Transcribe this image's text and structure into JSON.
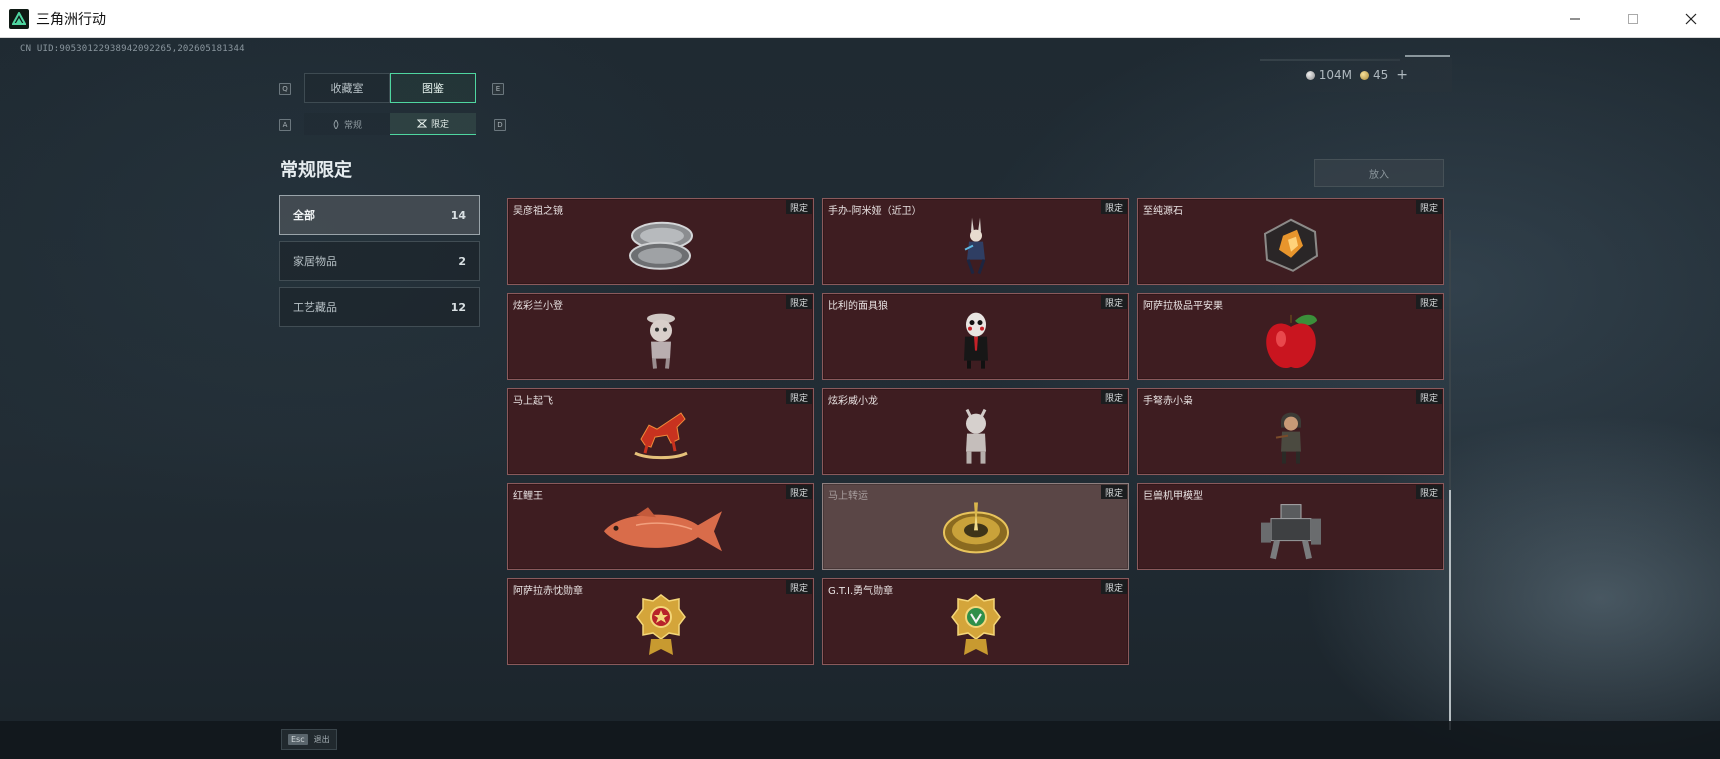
{
  "window": {
    "title": "三角洲行动",
    "minimize_icon": "minimize-icon",
    "maximize_icon": "maximize-icon",
    "close_icon": "close-icon"
  },
  "uid_text": "CN UID:905301229389420922​65,202605181344",
  "currency": {
    "silver_amount": "104M",
    "gold_amount": "45",
    "add_label": "+"
  },
  "tabs": {
    "primary": [
      {
        "key": "Q",
        "label": "收藏室",
        "active": false
      },
      {
        "label": "图鉴",
        "active": true
      },
      {
        "key": "E"
      }
    ],
    "secondary": [
      {
        "key": "A",
        "label": "常规",
        "icon": "flame-icon",
        "active": false
      },
      {
        "label": "限定",
        "icon": "limited-icon",
        "active": true
      },
      {
        "key": "D"
      }
    ]
  },
  "section_title": "常规限定",
  "sidebar": {
    "items": [
      {
        "label": "全部",
        "count": "14",
        "active": true
      },
      {
        "label": "家居物品",
        "count": "2",
        "active": false
      },
      {
        "label": "工艺藏品",
        "count": "12",
        "active": false
      }
    ]
  },
  "put_button": "放入",
  "items": [
    {
      "name": "吴彦祖之镜",
      "tag": "限定",
      "icon": "compact-mirror-icon"
    },
    {
      "name": "手办-阿米娅（近卫）",
      "tag": "限定",
      "icon": "figurine-amiya-icon"
    },
    {
      "name": "至纯源石",
      "tag": "限定",
      "icon": "originium-crystal-icon"
    },
    {
      "name": "炫彩兰小登",
      "tag": "限定",
      "icon": "figurine-doll-icon"
    },
    {
      "name": "比利的面具狼",
      "tag": "限定",
      "icon": "billy-puppet-icon"
    },
    {
      "name": "阿萨拉极品平安果",
      "tag": "限定",
      "icon": "red-apple-icon"
    },
    {
      "name": "马上起飞",
      "tag": "限定",
      "icon": "red-horse-icon"
    },
    {
      "name": "炫彩威小龙",
      "tag": "限定",
      "icon": "figurine-dragon-icon"
    },
    {
      "name": "手弩赤小枭",
      "tag": "限定",
      "icon": "figurine-crossbow-icon"
    },
    {
      "name": "红鲤王",
      "tag": "限定",
      "icon": "koi-fish-icon"
    },
    {
      "name": "马上转运",
      "tag": "限定",
      "icon": "golden-compass-icon",
      "hover": true
    },
    {
      "name": "巨兽机甲模型",
      "tag": "限定",
      "icon": "mech-model-icon"
    },
    {
      "name": "阿萨拉赤忱勋章",
      "tag": "限定",
      "icon": "gold-medal-red-icon"
    },
    {
      "name": "G.T.I.勇气勋章",
      "tag": "限定",
      "icon": "gold-medal-green-icon"
    }
  ],
  "bottom": {
    "esc_key": "Esc",
    "esc_label": "退出"
  }
}
